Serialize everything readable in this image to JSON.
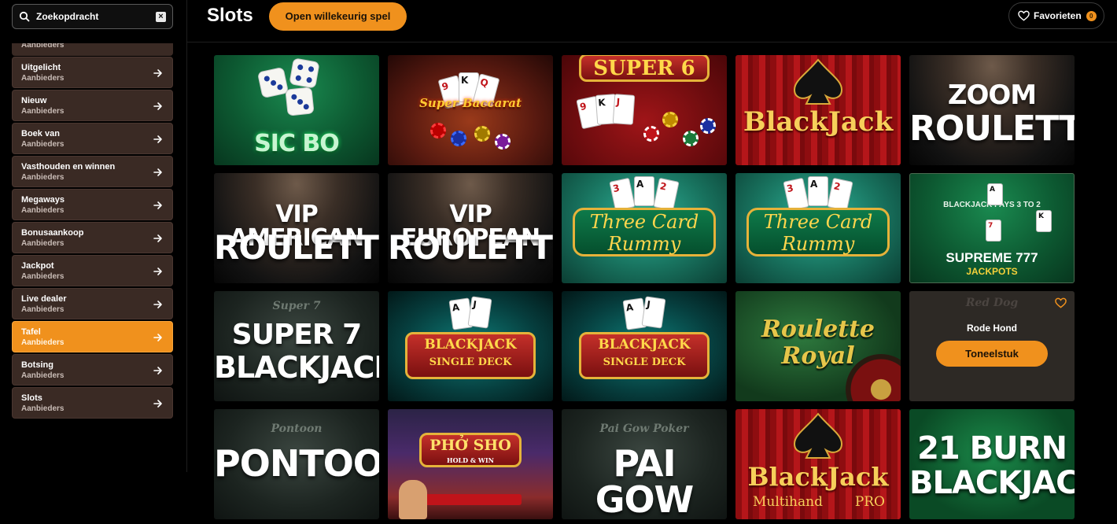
{
  "search": {
    "placeholder": "Zoekopdracht"
  },
  "sidebar": {
    "partial_label": "Aanbieders",
    "items": [
      {
        "title": "Uitgelicht",
        "sub": "Aanbieders",
        "active": false
      },
      {
        "title": "Nieuw",
        "sub": "Aanbieders",
        "active": false
      },
      {
        "title": "Boek van",
        "sub": "Aanbieders",
        "active": false
      },
      {
        "title": "Vasthouden en winnen",
        "sub": "Aanbieders",
        "active": false
      },
      {
        "title": "Megaways",
        "sub": "Aanbieders",
        "active": false
      },
      {
        "title": "Bonusaankoop",
        "sub": "Aanbieders",
        "active": false
      },
      {
        "title": "Jackpot",
        "sub": "Aanbieders",
        "active": false
      },
      {
        "title": "Live dealer",
        "sub": "Aanbieders",
        "active": false
      },
      {
        "title": "Tafel",
        "sub": "Aanbieders",
        "active": true
      },
      {
        "title": "Botsing",
        "sub": "Aanbieders",
        "active": false
      },
      {
        "title": "Slots",
        "sub": "Aanbieders",
        "active": false
      }
    ]
  },
  "header": {
    "title": "Slots",
    "random_label": "Open willekeurig spel",
    "favorites_label": "Favorieten",
    "favorites_count": "0"
  },
  "games": {
    "sicbo": "SIC BO",
    "super_baccarat": "Super Baccarat",
    "super6": "SUPER 6",
    "blackjack1": "BlackJack",
    "zoom1": "ZOOM",
    "zoom2": "ROULETTE",
    "vipam1": "VIP AMERICAN",
    "vipam2": "ROULETTE",
    "vipeu1": "VIP EUROPEAN",
    "vipeu2": "ROULETTE",
    "tcr_a1": "Three Card",
    "tcr_a2": "Rummy",
    "tcr_b1": "Three Card",
    "tcr_b2": "Rummy",
    "supreme1": "SUPREME 777",
    "supreme2": "JACKPOTS",
    "supreme_sub": "BLACKJACK PAYS 3 TO 2",
    "s7_top": "Super 7",
    "s7_1": "SUPER 7",
    "s7_2": "BLACKJACK",
    "bjsd_a1": "BLACKJACK",
    "bjsd_a2": "SINGLE DECK",
    "bjsd_b1": "BLACKJACK",
    "bjsd_b2": "SINGLE DECK",
    "rr1": "Roulette",
    "rr2": "Royal",
    "rodehond_bg": "Red Dog",
    "rodehond_title": "Rode Hond",
    "rodehond_play": "Toneelstuk",
    "pontoon_top": "Pontoon",
    "pontoon": "PONTOON",
    "pho": "PHỞ SHO",
    "pho_sub": "HOLD & WIN",
    "paigow_top": "Pai Gow Poker",
    "paigow": "PAI GOW",
    "bjmh1": "BlackJack",
    "bjmh2": "Multihand",
    "bjmh3": "PRO",
    "burn1": "21 BURN",
    "burn2": "BLACKJACK"
  },
  "colors": {
    "accent": "#f0911d",
    "sidebar_item": "#3a2a24",
    "background": "#000000"
  }
}
